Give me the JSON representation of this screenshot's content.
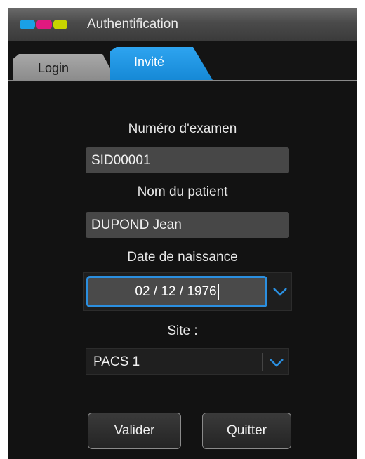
{
  "window": {
    "title": "Authentification",
    "logo_colors": [
      "#1aa0e6",
      "#e0197f",
      "#c8d400"
    ]
  },
  "tabs": [
    {
      "label": "Login",
      "active": false
    },
    {
      "label": "Invité",
      "active": true
    }
  ],
  "form": {
    "exam_number_label": "Numéro d'examen",
    "exam_number_value": "SID00001",
    "patient_name_label": "Nom du patient",
    "patient_name_value": "DUPOND Jean",
    "birth_date_label": "Date de naissance",
    "birth_date_value": "02 / 12 / 1976",
    "site_label": "Site :",
    "site_value": "PACS 1"
  },
  "buttons": {
    "validate_label": "Valider",
    "quit_label": "Quitter"
  },
  "colors": {
    "accent": "#1a8fe0",
    "background": "#121212",
    "field": "#474747"
  },
  "icons": {
    "date_dropdown": "chevron-down-icon",
    "site_dropdown": "chevron-down-icon"
  }
}
